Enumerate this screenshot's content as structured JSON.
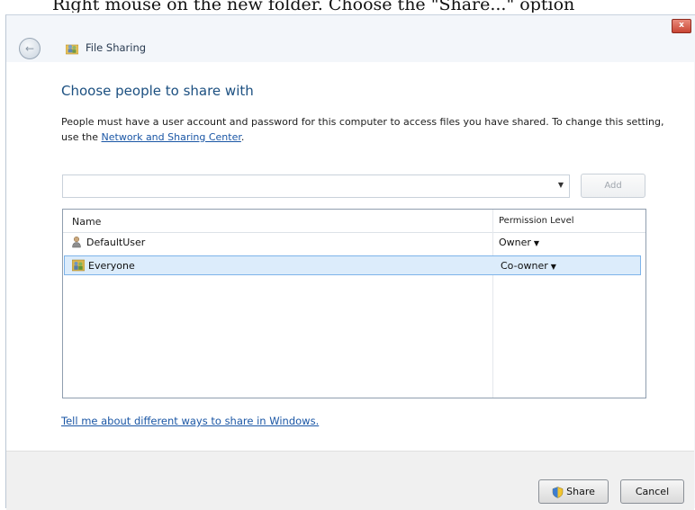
{
  "caption": "Right mouse on the new folder. Choose the \"Share...\" option",
  "window": {
    "title": "File Sharing",
    "close_glyph": "x",
    "back_glyph": "←"
  },
  "heading": "Choose people to share with",
  "description": {
    "text": "People must have a user account and password for this computer to access files you have shared. To change this setting, use the ",
    "link": "Network and Sharing Center",
    "suffix": "."
  },
  "picker": {
    "value": "",
    "arrow": "▼",
    "add_label": "Add"
  },
  "list": {
    "columns": [
      "Name",
      "Permission Level"
    ],
    "rows": [
      {
        "name": "DefaultUser",
        "permission": "Owner",
        "icon": "user-icon",
        "selected": false
      },
      {
        "name": "Everyone",
        "permission": "Co-owner",
        "icon": "group-icon",
        "selected": true
      }
    ],
    "dropdown_glyph": "▼"
  },
  "help_link": "Tell me about different ways to share in Windows.",
  "buttons": {
    "share": "Share",
    "cancel": "Cancel"
  },
  "colors": {
    "accent": "#1c5081",
    "link": "#1a56a5",
    "selection": "#dcecfb"
  }
}
